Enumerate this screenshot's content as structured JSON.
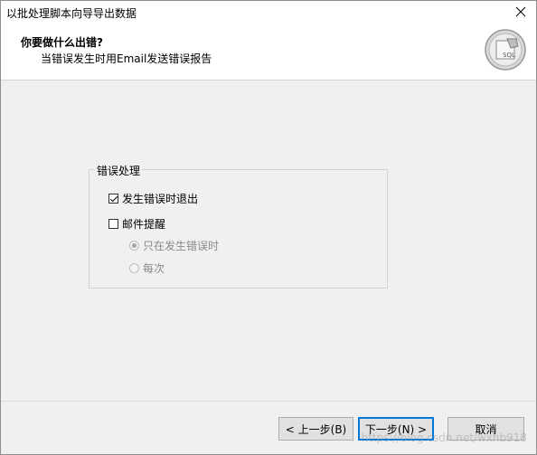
{
  "window": {
    "title": "以批处理脚本向导导出数据",
    "close_glyph": "✕"
  },
  "header": {
    "title": "你要做什么出错?",
    "subtitle": "当错误发生时用Email发送错误报告",
    "logo_text": "SQL"
  },
  "error_group": {
    "title": "错误处理",
    "exit_on_error": {
      "label": "发生错误时退出",
      "checked": true
    },
    "email_alert": {
      "label": "邮件提醒",
      "checked": false
    },
    "options": [
      {
        "label": "只在发生错误时",
        "selected": true
      },
      {
        "label": "每次",
        "selected": false
      }
    ]
  },
  "buttons": {
    "back": "< 上一步(B)",
    "next": "下一步(N) >",
    "cancel": "取消"
  },
  "watermark": "https://blog.csdn.net/wxhb918"
}
